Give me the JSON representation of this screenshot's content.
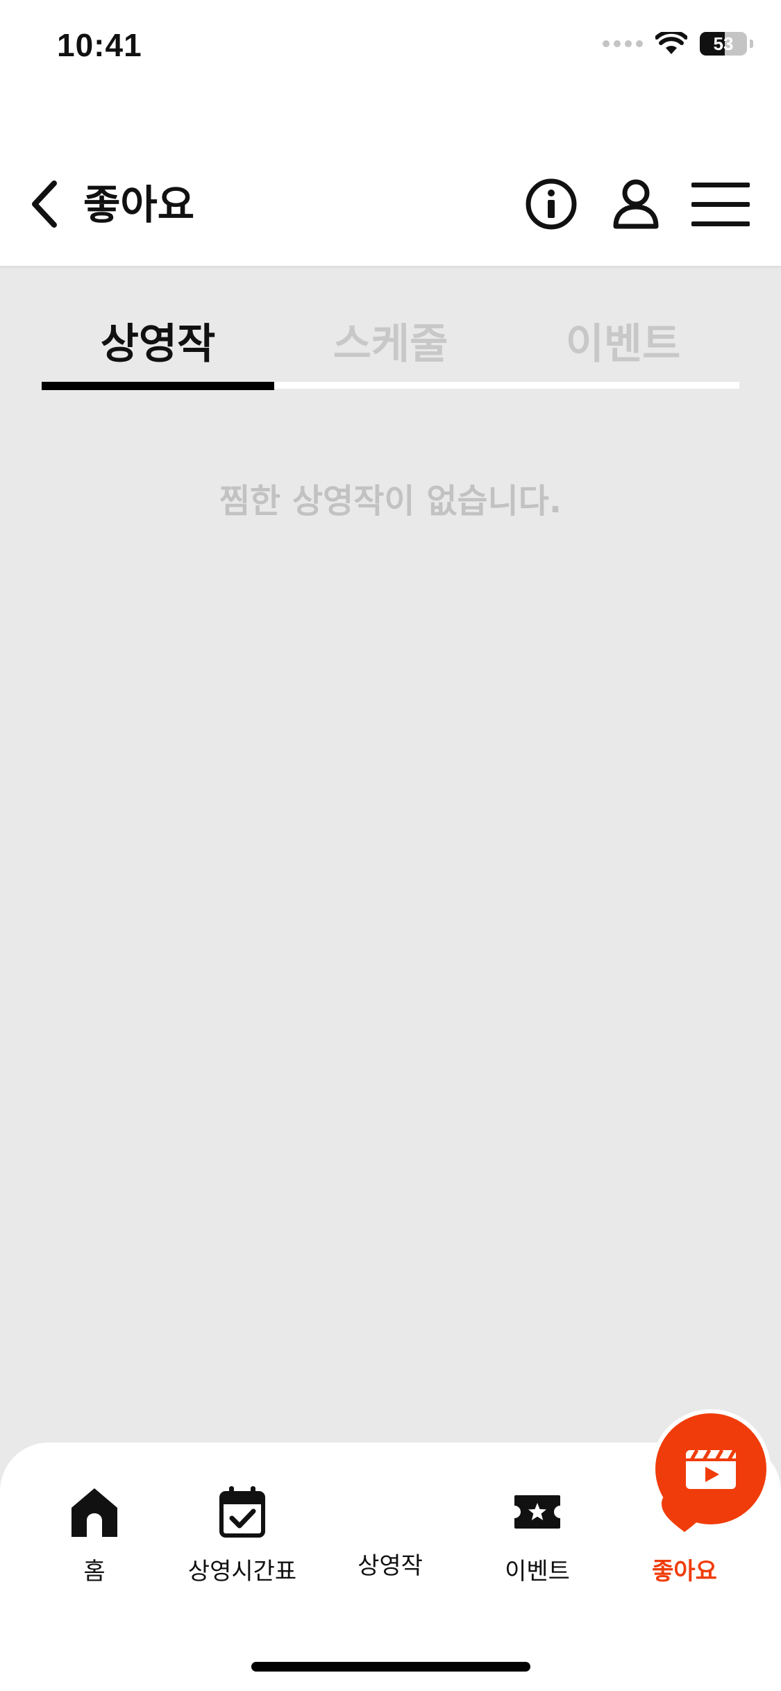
{
  "status_bar": {
    "time": "10:41",
    "battery_level": "53",
    "battery_fraction": 0.53
  },
  "header": {
    "title": "좋아요",
    "icons": [
      "chevron-left-icon",
      "info-icon",
      "user-icon",
      "menu-icon"
    ]
  },
  "tabs": [
    {
      "label": "상영작",
      "active": true
    },
    {
      "label": "스케줄",
      "active": false
    },
    {
      "label": "이벤트",
      "active": false
    }
  ],
  "empty_message": "찜한 상영작이 없습니다.",
  "bottom_nav": {
    "items": [
      {
        "label": "홈",
        "icon": "home-icon"
      },
      {
        "label": "상영시간표",
        "icon": "calendar-check-icon"
      },
      {
        "label": "상영작",
        "icon": "film-clapper-icon"
      },
      {
        "label": "이벤트",
        "icon": "ticket-star-icon"
      },
      {
        "label": "좋아요",
        "icon": "heart-icon",
        "active": true
      }
    ]
  },
  "colors": {
    "accent": "#f03c0a",
    "background": "#e9e9e9",
    "inactive_tab": "#c8c8c8",
    "empty_text": "#c2c2c2"
  }
}
